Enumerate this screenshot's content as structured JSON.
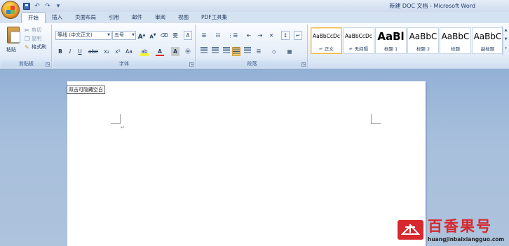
{
  "window": {
    "title": "新建 DOC 文档 - Microsoft Word"
  },
  "quick_access": [
    {
      "icon": "save-icon"
    },
    {
      "icon": "undo-icon",
      "glyph": "↶"
    },
    {
      "icon": "redo-icon",
      "glyph": "↷"
    },
    {
      "icon": "customize-icon",
      "glyph": "▾"
    }
  ],
  "tabs": [
    "开始",
    "插入",
    "页面布局",
    "引用",
    "邮件",
    "审阅",
    "视图",
    "PDF工具集"
  ],
  "clipboard": {
    "paste": "粘贴",
    "cut": "剪切",
    "copy": "复制",
    "format_painter": "格式刷",
    "group_label": "剪贴板"
  },
  "font": {
    "name": "等线 (中文正文)",
    "size": "五号",
    "grow": "A",
    "shrink": "A",
    "clear": "⌫",
    "phonetic": "雯",
    "border": "A",
    "bold": "B",
    "italic": "I",
    "underline": "U",
    "strike": "abe",
    "subscript": "x₂",
    "superscript": "x²",
    "case": "Aa",
    "highlight": "ab",
    "color": "A",
    "shade": "A",
    "enclose": "㊥",
    "group_label": "字体"
  },
  "paragraph": {
    "bullets": "☰",
    "numbering": "☷",
    "multilevel": "⋮☰",
    "decrease": "⇤",
    "increase": "⇥",
    "chinese": "✕",
    "sort": "↕",
    "marks": "↵",
    "spacing": "☰",
    "shading": "◇",
    "borders": "▦",
    "group_label": "段落"
  },
  "styles": [
    {
      "sample": "AaBbCcDc",
      "name": "↵ 正文",
      "selected": true
    },
    {
      "sample": "AaBbCcDc",
      "name": "↵ 无间隔",
      "selected": false
    },
    {
      "sample": "AaBl",
      "name": "标题 1",
      "selected": false
    },
    {
      "sample": "AaBbC",
      "name": "标题 2",
      "selected": false
    },
    {
      "sample": "AaBbC",
      "name": "标题",
      "selected": false
    },
    {
      "sample": "AaBbC",
      "name": "副标题",
      "selected": false
    }
  ],
  "document": {
    "tooltip": "双击可隐藏空白",
    "para_mark": "↵"
  },
  "watermark": {
    "title": "百香果号",
    "url": "huangjinbaixiangguo.com"
  }
}
